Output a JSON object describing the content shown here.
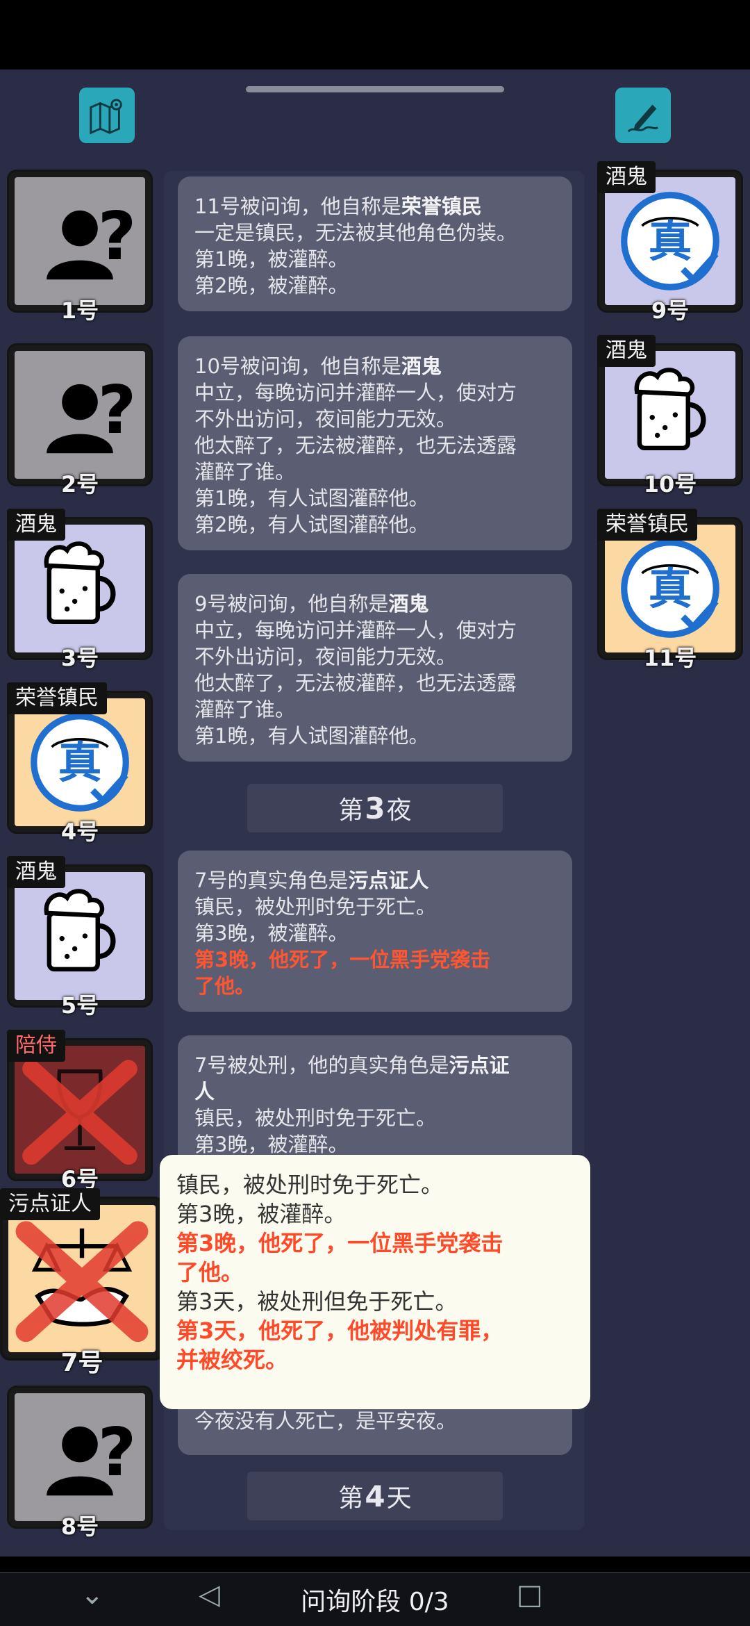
{
  "players_left": [
    {
      "num": "1号",
      "role": "",
      "type": "unknown"
    },
    {
      "num": "2号",
      "role": "",
      "type": "unknown"
    },
    {
      "num": "3号",
      "role": "酒鬼",
      "type": "drunk"
    },
    {
      "num": "4号",
      "role": "荣誉镇民",
      "type": "honor"
    },
    {
      "num": "5号",
      "role": "酒鬼",
      "type": "drunk"
    },
    {
      "num": "6号",
      "role": "陪侍",
      "type": "dead-attendant"
    },
    {
      "num": "7号",
      "role": "污点证人",
      "type": "dead-witness"
    },
    {
      "num": "8号",
      "role": "",
      "type": "unknown"
    }
  ],
  "players_right": [
    {
      "num": "9号",
      "role": "酒鬼",
      "type": "drunk-verified"
    },
    {
      "num": "10号",
      "role": "酒鬼",
      "type": "drunk"
    },
    {
      "num": "11号",
      "role": "荣誉镇民",
      "type": "honor"
    }
  ],
  "log": {
    "card1": {
      "prefix": "11号被问询，他自称是",
      "role": "荣誉镇民",
      "lines": [
        "一定是镇民，无法被其他角色伪装。",
        "第1晚，被灌醉。",
        "第2晚，被灌醉。"
      ]
    },
    "card2": {
      "prefix": "10号被问询，他自称是",
      "role": "酒鬼",
      "lines": [
        "中立，每晚访问并灌醉一人，使对方",
        "不外出访问，夜间能力无效。",
        "他太醉了，无法被灌醉，也无法透露",
        "灌醉了谁。",
        "第1晚，有人试图灌醉他。",
        "第2晚，有人试图灌醉他。"
      ]
    },
    "card3": {
      "prefix": "9号被问询，他自称是",
      "role": "酒鬼",
      "lines": [
        "中立，每晚访问并灌醉一人，使对方",
        "不外出访问，夜间能力无效。",
        "他太醉了，无法被灌醉，也无法透露",
        "灌醉了谁。",
        "第1晚，有人试图灌醉他。"
      ]
    },
    "night3": {
      "pre": "第",
      "num": "3",
      "post": "夜"
    },
    "card4": {
      "prefix": "7号的真实角色是",
      "role": "污点证人",
      "lines": [
        "镇民，被处刑时免于死亡。",
        "第3晚，被灌醉。"
      ],
      "red": [
        "第3晚，他死了，一位黑手党袭击",
        "了他。"
      ]
    },
    "card5": {
      "prefix": "7号被处刑，他的真实角色是",
      "role": "污点证",
      "role2": "人",
      "lines": [
        "镇民，被处刑时免于死亡。",
        "第3晚，被灌醉。"
      ]
    },
    "card6": {
      "text": "今夜没有人死亡，是平安夜。"
    },
    "day4": {
      "pre": "第",
      "num": "4",
      "post": "天"
    }
  },
  "popup": {
    "lines": [
      {
        "text": "镇民，被处刑时免于死亡。",
        "red": false
      },
      {
        "text": "第3晚，被灌醉。",
        "red": false
      },
      {
        "text": "第3晚，他死了，一位黑手党袭击",
        "red": true
      },
      {
        "text": "了他。",
        "red": true
      },
      {
        "text": "第3天，被处刑但免于死亡。",
        "red": false
      },
      {
        "text": "第3天，他死了，他被判处有罪，",
        "red": true
      },
      {
        "text": "并被绞死。",
        "red": true
      }
    ]
  },
  "bottom": {
    "phase": "问询阶段 0/3"
  },
  "icons": {
    "map": "map-pin-icon",
    "notes": "pen-note-icon",
    "unknown": "unknown-person-icon",
    "beer": "beer-mug-icon",
    "verified": "verified-seal-icon",
    "cross": "red-cross-icon"
  },
  "colors": {
    "background": "#2a2d45",
    "card": "#5b5e73",
    "accent": "#2aa7b8",
    "death_red": "#ff5530",
    "honor_bg": "#fcd9a3",
    "drunk_bg": "#c9c8ea"
  }
}
